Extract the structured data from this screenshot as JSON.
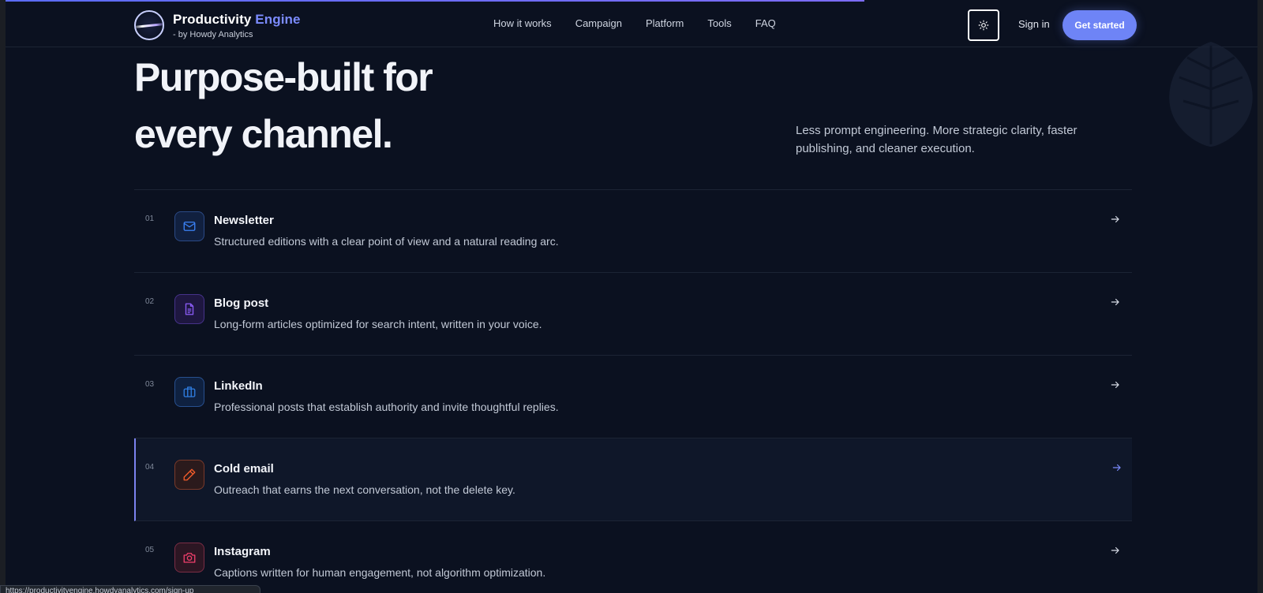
{
  "header": {
    "brand_main": "Productivity",
    "brand_accent": "Engine",
    "byline": "- by Howdy Analytics",
    "nav": [
      "How it works",
      "Campaign",
      "Platform",
      "Tools",
      "FAQ"
    ],
    "signin": "Sign in",
    "cta": "Get started"
  },
  "hero": {
    "title_line1": "Purpose-built for",
    "title_line2": "every channel.",
    "subtitle": "Less prompt engineering. More strategic clarity, faster publishing, and cleaner execution."
  },
  "channels": [
    {
      "num": "01",
      "title": "Newsletter",
      "desc": "Structured editions with a clear point of view and a natural reading arc.",
      "icon": "mail-icon",
      "color": "#3b82f6"
    },
    {
      "num": "02",
      "title": "Blog post",
      "desc": "Long-form articles optimized for search intent, written in your voice.",
      "icon": "document-icon",
      "color": "#8b5cf6"
    },
    {
      "num": "03",
      "title": "LinkedIn",
      "desc": "Professional posts that establish authority and invite thoughtful replies.",
      "icon": "briefcase-icon",
      "color": "#2f7de1"
    },
    {
      "num": "04",
      "title": "Cold email",
      "desc": "Outreach that earns the next conversation, not the delete key.",
      "icon": "pen-icon",
      "color": "#f25c2a",
      "active": true
    },
    {
      "num": "05",
      "title": "Instagram",
      "desc": "Captions written for human engagement, not algorithm optimization.",
      "icon": "camera-icon",
      "color": "#ef3f6b"
    }
  ],
  "status_url": "https://productivityengine.howdyanalytics.com/sign-up",
  "colors": {
    "background": "#0b1120",
    "accent": "#7c8cff",
    "cta": "#6e84f6",
    "active_bar": "#7c83f0"
  }
}
